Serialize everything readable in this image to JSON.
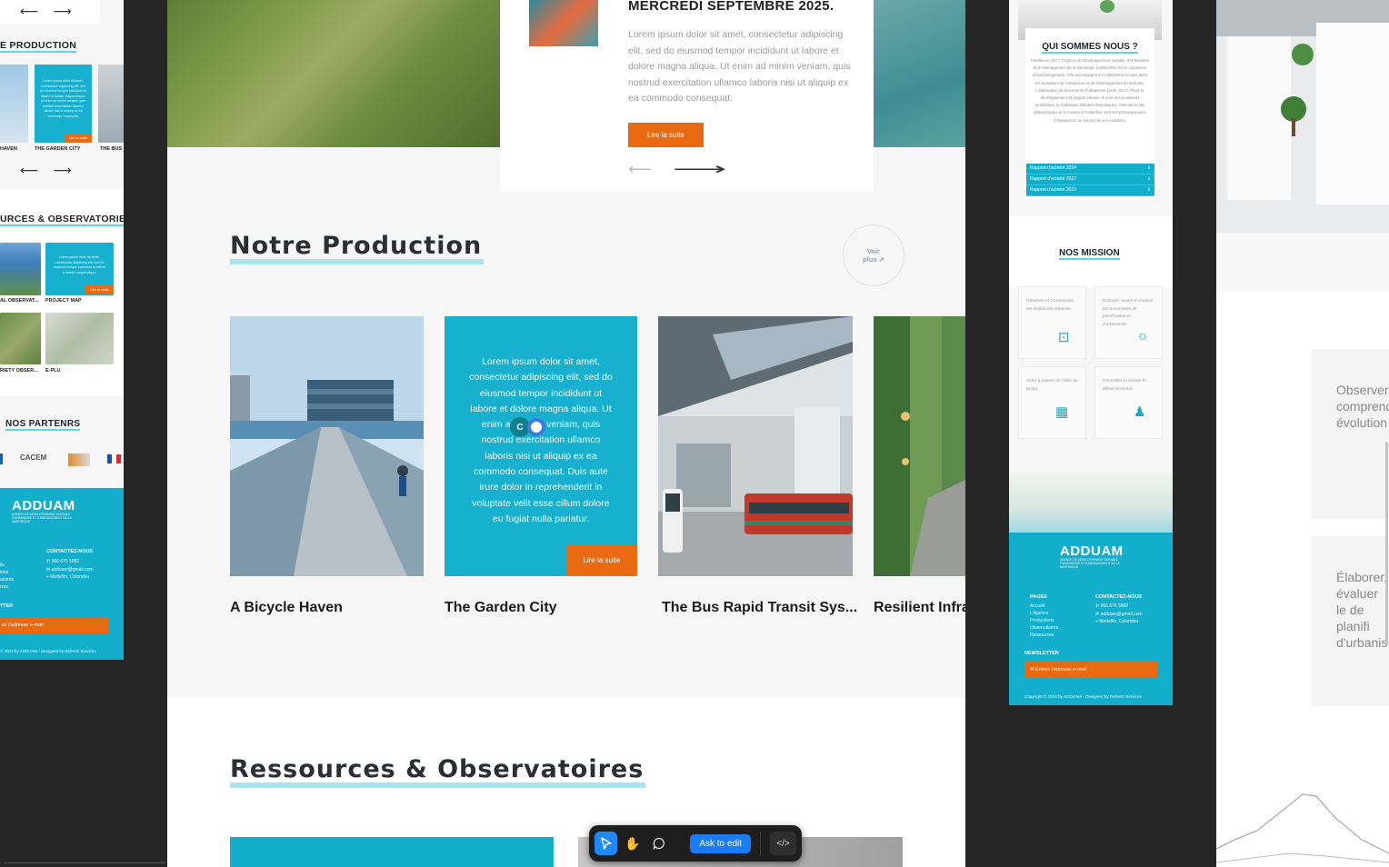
{
  "left_frame": {
    "production_title": "E PRODUCTION",
    "production_captions": [
      "HAVEN",
      "THE GARDEN CITY",
      "THE BUS"
    ],
    "production_card_text": "Lorem ipsum dolor sit amet, consectetur adipiscing elit, sed do eiusmod tempor incididunt ut labore et dolore magna aliqua. Ut enim ad minim veniam, quis nostrud exercitation ullamco laboris nisi ut aliquip ex ea commodo consequat.",
    "production_button": "Lire la suite",
    "resources_title": "URCES & OBSERVATORIES",
    "resources_captions": [
      "AL OBSERVAT...",
      "PROJECT MAP",
      "RIETY OBSER...",
      "E-PLU"
    ],
    "resources_card_text": "Lorem ipsum dolor sit amet, consectetur adipiscing elit, sed do eiusmod tempor incididunt ut labore et dolore magna aliqua.",
    "resources_button": "Lire la suite",
    "partners_title": "NOS PARTENRS",
    "partners": [
      "CACEM"
    ],
    "footer": {
      "logo": "ADDUAM",
      "logo_sub": "AGENCE DE DÉVELOPPEMENT DURABLE D'URBANISME ET D'AMÉNAGEMENT DE LA MARTINIQUE",
      "pages_lines": [
        "ils",
        "ions",
        "atoires",
        "rces"
      ],
      "contact_title": "CONTACTEZ-NOUS",
      "phone": "966 676 5882",
      "email": "adduam@gmail.com",
      "address": "Medellín, Colombia",
      "newsletter_title": "TTER",
      "newsletter_placeholder": "ez l'adresse e-mail",
      "copyright": "© 2024 by ADDUAM - Designed by Refresh Services"
    }
  },
  "center": {
    "news": {
      "title": "MERCREDI SEPTEMBRE 2025.",
      "body": "Lorem ipsum dolor sit amet, consectetur adipiscing elit, sed do eiusmod tempor incididunt ut labore et dolore magna aliqua. Ut enim ad minim veniam, quis nostrud exercitation ullamco laboris nisi ut aliquip ex ea commodo consequat.",
      "button": "Lire la suite",
      "arrow_prev": "⟵",
      "arrow_next": "⟶"
    },
    "production": {
      "title": "Notre Production",
      "voir_plus": [
        "Voir",
        "plus ↗"
      ],
      "cards": [
        {
          "caption": "A Bicycle Haven"
        },
        {
          "caption": "The Garden City",
          "text": "Lorem ipsum dolor sit amet, consectetur adipiscing elit, sed do eiusmod tempor incididunt ut labore et dolore magna aliqua. Ut enim ad minim veniam, quis nostrud exercitation ullamco laboris nisi ut aliquip ex ea commodo consequat. Duis aute irure dolor in reprehenderit in voluptate velit esse cillum dolore eu fugiat nulla pariatur.",
          "button": "Lire la suite"
        },
        {
          "caption": "The Bus Rapid Transit Sys..."
        },
        {
          "caption": "Resilient Infra"
        }
      ]
    },
    "resources": {
      "title": "Ressources & Observatoires"
    },
    "cursor_badge": "C"
  },
  "right_frame": {
    "about_title": "QUI SOMMES NOUS ?",
    "about_text": "Fondée en 1977, l'Agence de Développement Durable, d'Urbanisme et d'Aménagement de la Martinique (ADDUAM) est un organisme d'études/ingénierie. Elle accompagne les collectivités locales dans les domaines de l'urbanisme et de l'aménagement du territoire. L'élaboration de documents d'urbanisme (SAR, SCoT, PLU), le développement de projets urbains, le suivi des évolutions territoriales, la réalisation d'études thématiques, l'animation des débats locaux et le conseil et l'expertise sont ses principaux axes d'intervention au service de ses membres.",
    "reports": [
      "Rapport d'activité 2024",
      "Rapport d'activité 2022",
      "Rapport d'activité 2023"
    ],
    "mission_title": "NOS MISSION",
    "missions": [
      "Observer et comprendre les évolutions urbaines.",
      "Élaborer, suivre et évaluer les documents de planification et d'urbanisme.",
      "Aider à passer de l'idée au projet.",
      "Conseiller et animer le débat territorial."
    ],
    "footer": {
      "logo": "ADDUAM",
      "logo_sub": "AGENCE DE DÉVELOPPEMENT DURABLE D'URBANISME ET D'AMÉNAGEMENT DE LA MARTINIQUE",
      "pages_title": "PAGES",
      "pages": [
        "Accueil",
        "L'Agence",
        "Productions",
        "Observatoires",
        "Ressources"
      ],
      "contact_title": "CONTACTEZ-NOUS",
      "phone": "966 676 5882",
      "email": "adduam@gmail.com",
      "address": "Medellín, Colombia",
      "newsletter_title": "NEWSLETTER",
      "newsletter_placeholder": "Entrez l'adresse e-mail",
      "copyright": "Copyright © 2024 by ADDUAM - Designed by Refresh Services"
    }
  },
  "far_right": {
    "card1": "Observer comprend évolution",
    "card2": "Élaborer, évaluer le de planifi d'urbanis"
  },
  "toolbar": {
    "ask_label": "Ask to edit",
    "code_icon_label": "</>",
    "active_color": "#1e88ff"
  },
  "colors": {
    "brand_teal": "#12aecb",
    "accent_orange": "#e96a10",
    "title_underline": "#a9e3ec"
  }
}
